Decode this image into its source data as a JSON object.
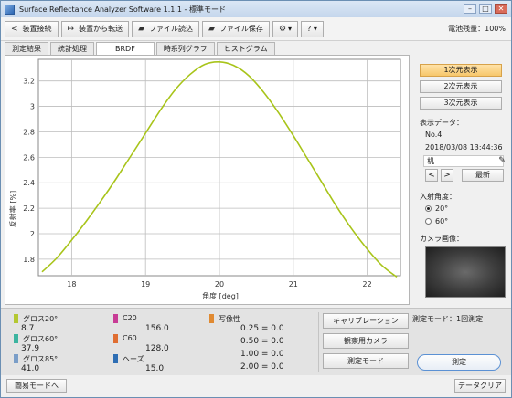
{
  "window": {
    "title": "Surface Reflectance Analyzer Software 1.1.1 - 標準モード",
    "min_label": "–",
    "max_label": "□",
    "close_label": "✕"
  },
  "toolbar": {
    "disconnect_label": "装置接続",
    "transfer_label": "装置から転送",
    "load_label": "ファイル読込",
    "save_label": "ファイル保存",
    "settings_label": "▾",
    "help_label": "? ▾",
    "battery": "電池残量：100%"
  },
  "tabs": [
    "測定結果",
    "統計処理",
    "BRDF",
    "時系列グラフ",
    "ヒストグラム"
  ],
  "active_tab": "BRDF",
  "chart_data": {
    "type": "line",
    "xlabel": "角度 [deg]",
    "ylabel": "反射率 [%]",
    "xlim": [
      17.55,
      22.45
    ],
    "ylim": [
      1.67,
      3.37
    ],
    "x_ticks": [
      18,
      19,
      20,
      21,
      22
    ],
    "y_ticks": [
      1.8,
      2,
      2.2,
      2.4,
      2.6,
      2.8,
      3,
      3.2
    ],
    "grid": true,
    "series_color": "#a8c41a",
    "series": [
      {
        "x": [
          17.6,
          17.8,
          18.0,
          18.2,
          18.4,
          18.6,
          18.8,
          19.0,
          19.2,
          19.4,
          19.6,
          19.8,
          20.0,
          20.2,
          20.4,
          20.6,
          20.8,
          21.0,
          21.2,
          21.4,
          21.6,
          21.8,
          22.0,
          22.2,
          22.4
        ],
        "y": [
          1.7,
          1.81,
          1.95,
          2.1,
          2.26,
          2.43,
          2.61,
          2.79,
          2.97,
          3.13,
          3.25,
          3.33,
          3.35,
          3.32,
          3.24,
          3.11,
          2.95,
          2.77,
          2.58,
          2.39,
          2.2,
          2.03,
          1.88,
          1.75,
          1.66
        ]
      }
    ]
  },
  "side": {
    "dim1": "1次元表示",
    "dim2": "2次元表示",
    "dim3": "3次元表示",
    "display_data_label": "表示データ：",
    "data_no": "No.4",
    "data_date": "2018/03/08 13:44:36",
    "data_name": "机",
    "prev_label": "<",
    "next_label": ">",
    "latest_label": "最新",
    "angle_label": "入射角度：",
    "angle_20": "20°",
    "angle_60": "60°",
    "camera_label": "カメラ画像："
  },
  "results": {
    "gloss20_label": "グロス20°",
    "gloss20_val": "8.7",
    "gloss60_label": "グロス60°",
    "gloss60_val": "37.9",
    "gloss85_label": "グロス85°",
    "gloss85_val": "41.0",
    "c20_label": "C20",
    "c20_val": "156.0",
    "c60_label": "C60",
    "c60_val": "128.0",
    "haze_label": "ヘーズ",
    "haze_val": "15.0",
    "image_label": "写像性",
    "img1": "0.25 = 0.0",
    "img2": "0.50 = 0.0",
    "img3": "1.00 = 0.0",
    "img4": "2.00 = 0.0",
    "colors": {
      "gloss20": "#b4c832",
      "gloss60": "#3cb4a0",
      "gloss85": "#7a9ec8",
      "c20": "#c83c96",
      "c60": "#e06e32",
      "haze": "#2e6eb4",
      "image": "#e08a32"
    }
  },
  "actions": {
    "calibration": "キャリブレーション",
    "camera": "観察用カメラ",
    "mode": "測定モード",
    "mode_status": "測定モード：1回測定",
    "measure": "測定"
  },
  "footer": {
    "simple_mode": "簡易モードへ",
    "clear": "データクリア"
  }
}
